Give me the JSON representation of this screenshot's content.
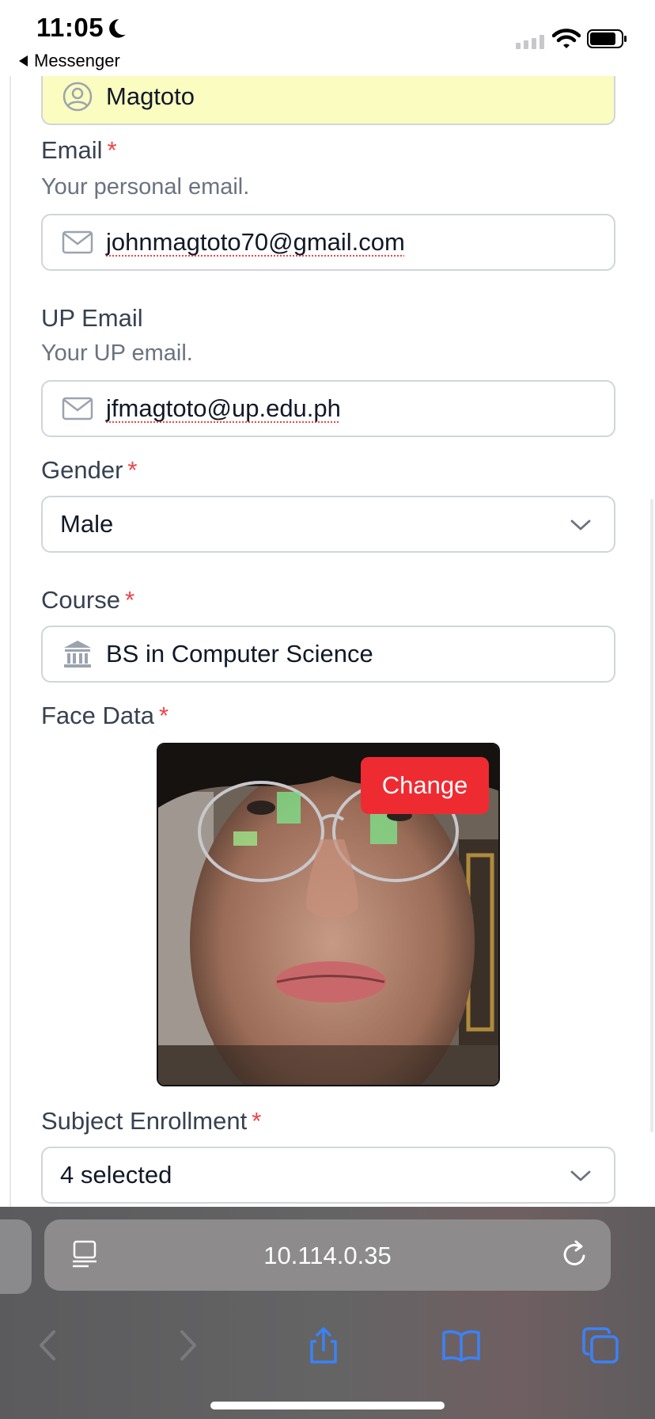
{
  "status_bar": {
    "time": "11:05",
    "back_app": "Messenger"
  },
  "form": {
    "last_name_value": "Magtoto",
    "email": {
      "label": "Email",
      "required": "*",
      "help": "Your personal email.",
      "value": "johnmagtoto70@gmail.com"
    },
    "up_email": {
      "label": "UP Email",
      "help": "Your UP email.",
      "value": "jfmagtoto@up.edu.ph"
    },
    "gender": {
      "label": "Gender",
      "required": "*",
      "value": "Male"
    },
    "course": {
      "label": "Course",
      "required": "*",
      "value": "BS in Computer Science"
    },
    "face_data": {
      "label": "Face Data",
      "required": "*",
      "change_label": "Change"
    },
    "subject_enrollment": {
      "label": "Subject Enrollment",
      "required": "*",
      "value": "4 selected"
    }
  },
  "browser": {
    "url": "10.114.0.35"
  },
  "colors": {
    "required": "#ef4444",
    "change_button": "#ef2b32",
    "filled_field": "#fafcc0",
    "toolbar_icon": "#3b82f6"
  },
  "icons": [
    "moon-icon",
    "signal-icon",
    "wifi-icon",
    "battery-icon",
    "user-circle-icon",
    "mail-icon",
    "chevron-down-icon",
    "bank-icon",
    "reader-icon",
    "reload-icon",
    "back-icon",
    "forward-icon",
    "share-icon",
    "bookmarks-icon",
    "tabs-icon"
  ]
}
